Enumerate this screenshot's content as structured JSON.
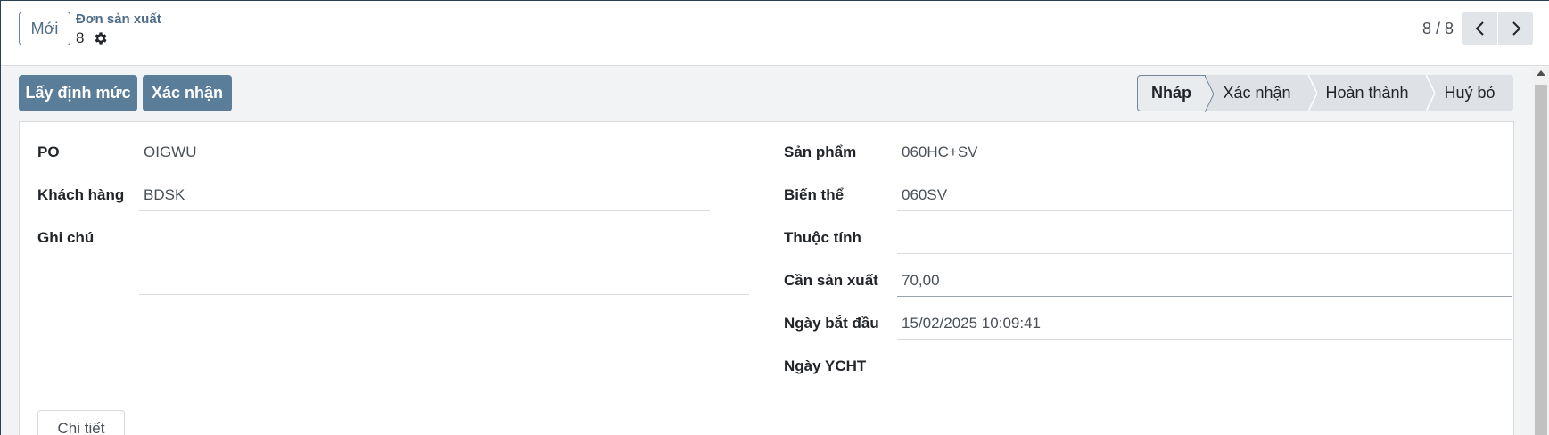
{
  "control_panel": {
    "new_button": "Mới",
    "breadcrumb_parent": "Đơn sản xuất",
    "record_id": "8",
    "pager_value": "8 / 8"
  },
  "statusbar": {
    "get_norm_button": "Lấy định mức",
    "confirm_button": "Xác nhận",
    "stages": [
      "Nháp",
      "Xác nhận",
      "Hoàn thành",
      "Huỷ bỏ"
    ],
    "active_stage": "Nháp"
  },
  "form": {
    "left": {
      "po_label": "PO",
      "po_value": "OIGWU",
      "customer_label": "Khách hàng",
      "customer_value": "BDSK",
      "note_label": "Ghi chú",
      "note_value": ""
    },
    "right": {
      "product_label": "Sản phẩm",
      "product_value": "060HC+SV",
      "variant_label": "Biến thể",
      "variant_value": "060SV",
      "attribute_label": "Thuộc tính",
      "attribute_value": "",
      "qty_label": "Cần sản xuất",
      "qty_value": "70,00",
      "start_label": "Ngày bắt đầu",
      "start_value": "15/02/2025 10:09:41",
      "ycht_label": "Ngày YCHT",
      "ycht_value": ""
    },
    "detail_button": "Chi tiết"
  },
  "colors": {
    "action_button": "#5a7e99",
    "accent_text": "#4e6b88",
    "stage_bg": "#dee2e6"
  }
}
